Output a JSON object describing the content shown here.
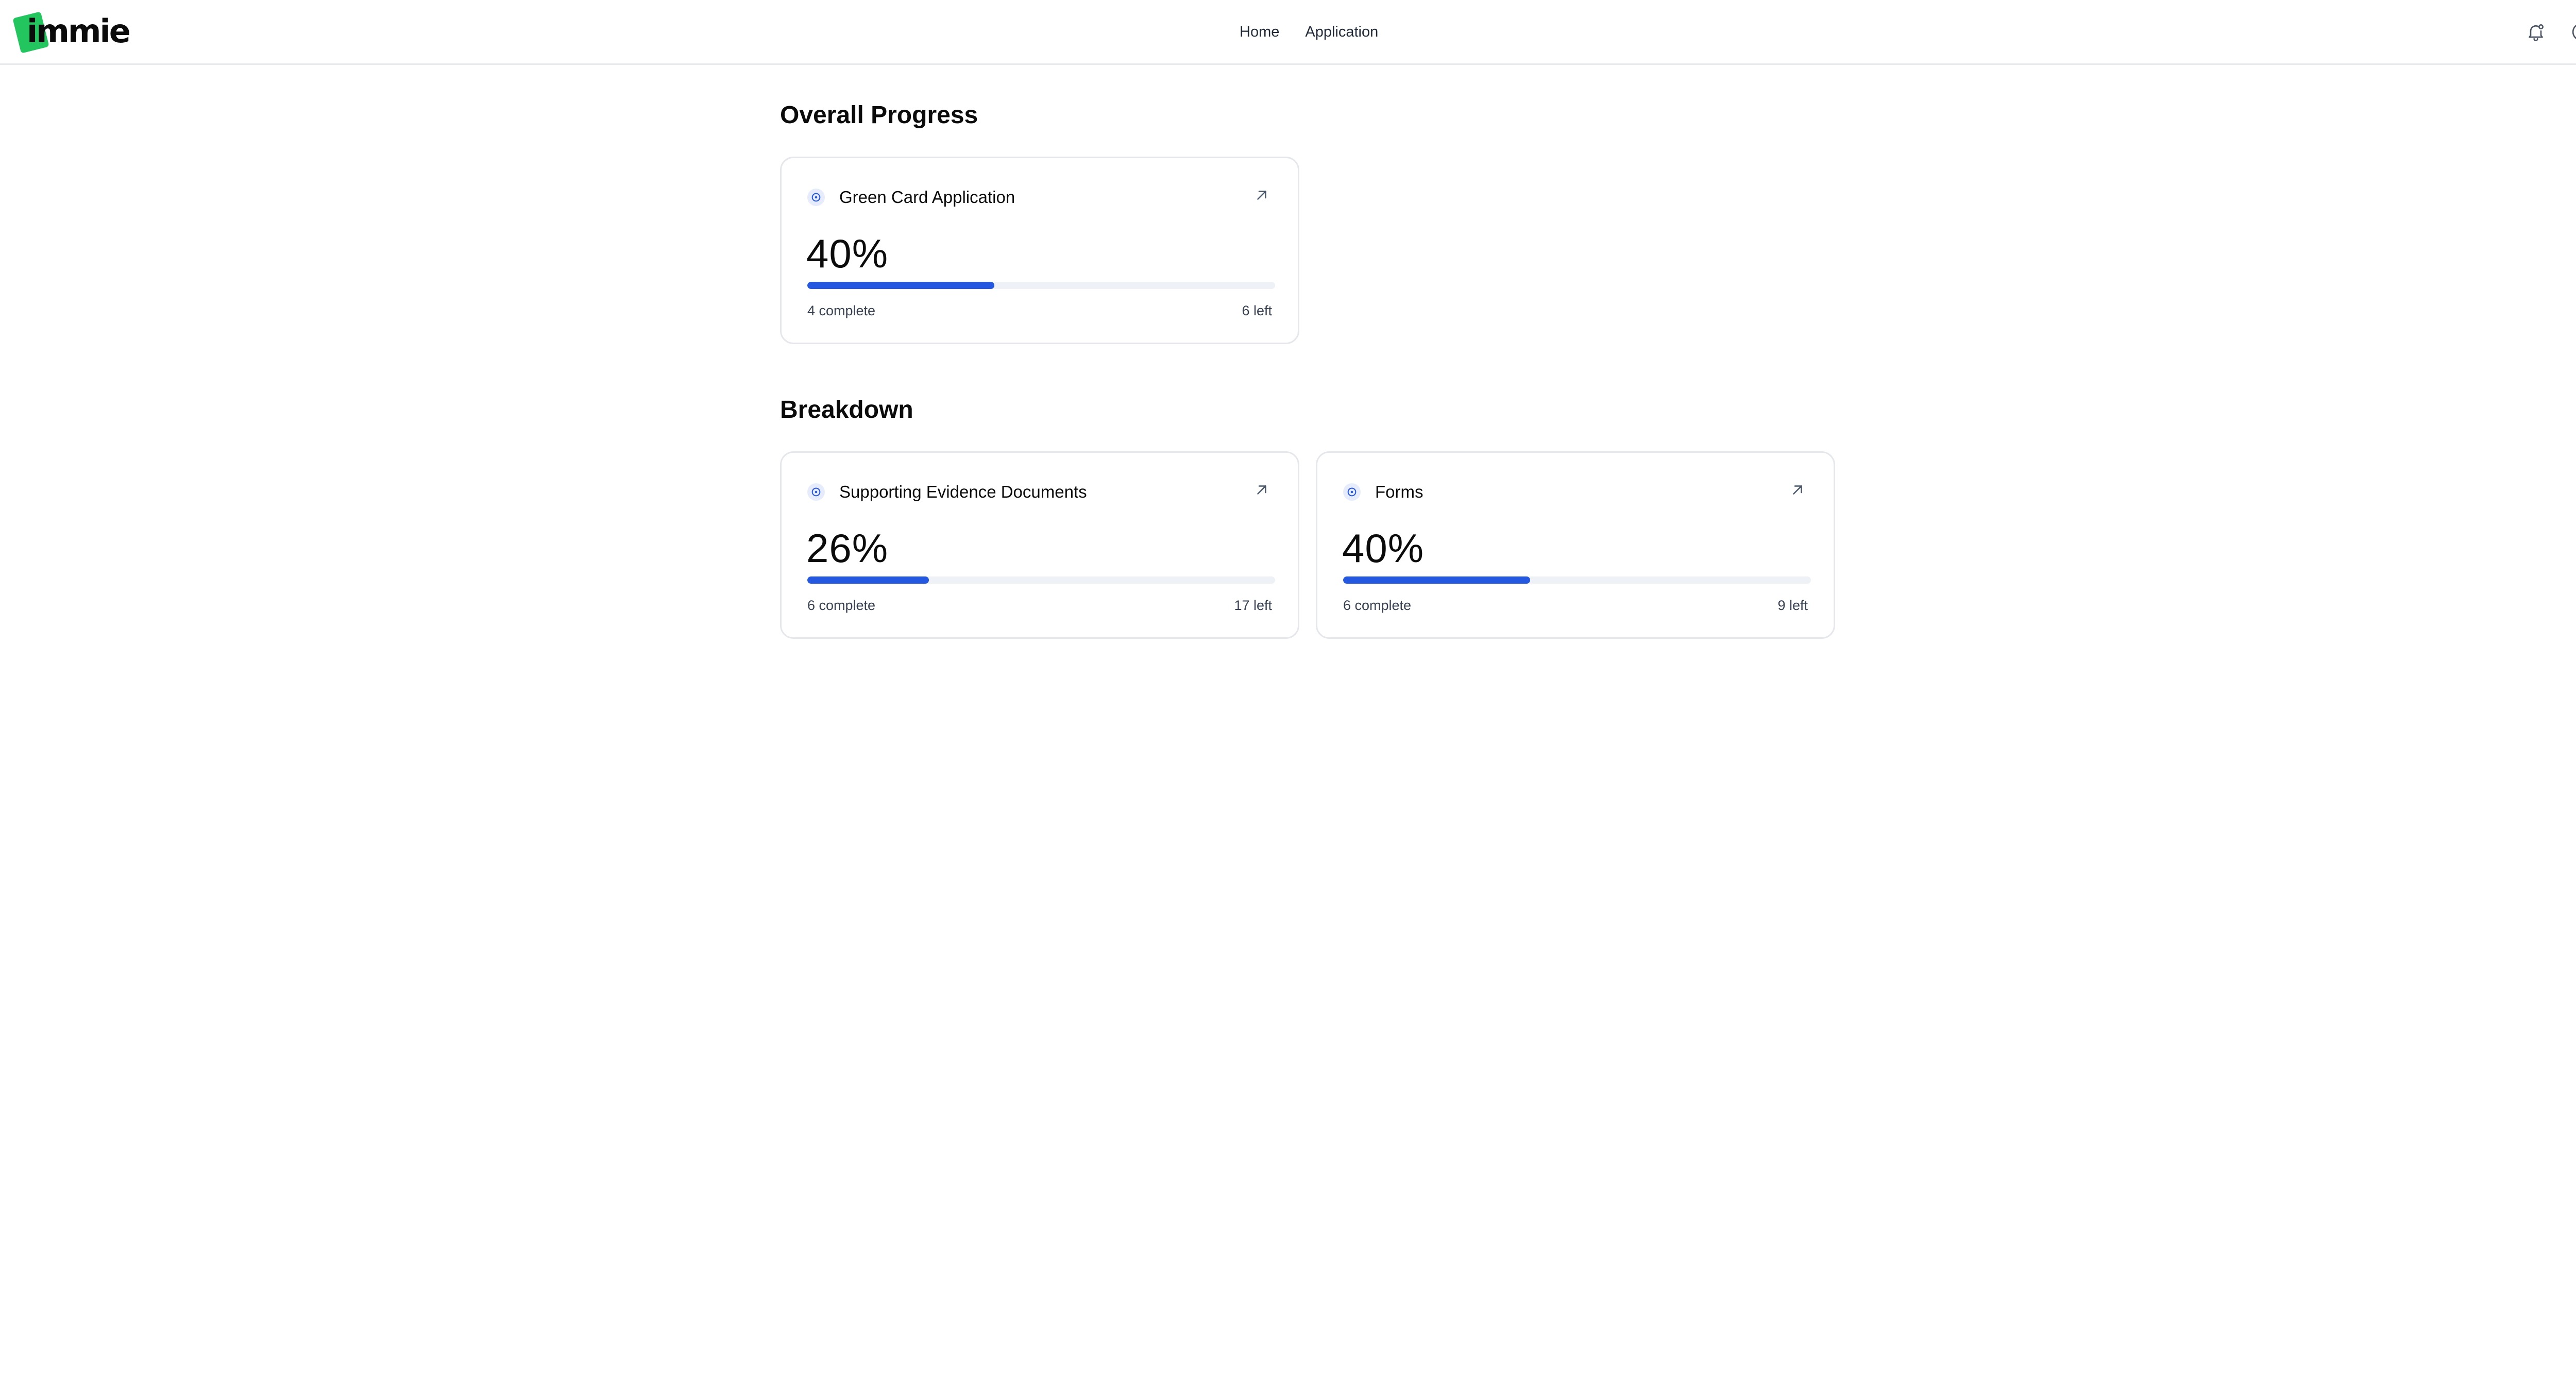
{
  "brand": {
    "logo_text": "immie",
    "accent_color": "#22c55e"
  },
  "nav": {
    "items": [
      {
        "label": "Home"
      },
      {
        "label": "Application"
      }
    ]
  },
  "header_icons": {
    "notifications": "bell-icon",
    "account": "user-circle-icon"
  },
  "overall": {
    "section_title": "Overall Progress",
    "card": {
      "title": "Green Card Application",
      "percent_label": "40%",
      "progress": 0.4,
      "complete_label": "4 complete",
      "left_label": "6 left"
    }
  },
  "breakdown": {
    "section_title": "Breakdown",
    "cards": [
      {
        "title": "Supporting Evidence Documents",
        "percent_label": "26%",
        "progress": 0.26,
        "complete_label": "6 complete",
        "left_label": "17 left"
      },
      {
        "title": "Forms",
        "percent_label": "40%",
        "progress": 0.4,
        "complete_label": "6 complete",
        "left_label": "9 left"
      }
    ]
  },
  "colors": {
    "progress_fill": "#2558e0",
    "progress_track": "#eef1f5"
  }
}
